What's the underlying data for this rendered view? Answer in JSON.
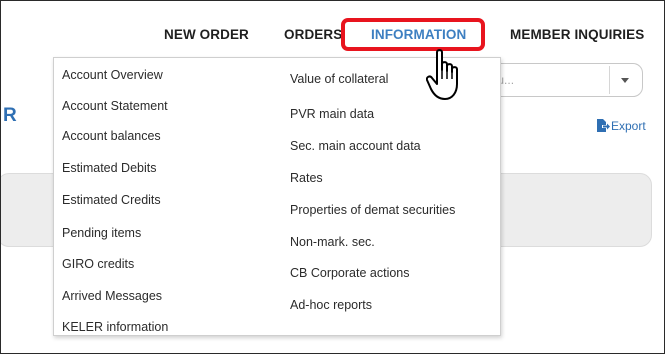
{
  "nav": {
    "new_order": "NEW ORDER",
    "orders": "ORDERS",
    "information": "INFORMATION",
    "member_inquiries": "MEMBER INQUIRIES"
  },
  "header_fragment": "R",
  "search": {
    "placeholder": "enu..."
  },
  "export_label": "Export",
  "menu": {
    "left_column": [
      "Account Overview",
      "Account Statement",
      "Account balances",
      "Estimated Debits",
      "Estimated Credits",
      "Pending items",
      "GIRO credits",
      "Arrived Messages",
      "KELER information"
    ],
    "right_column": [
      "Value of collateral",
      "PVR main data",
      "Sec. main account data",
      "Rates",
      "Properties of demat securities",
      "Non-mark. sec.",
      "CB Corporate actions",
      "Ad-hoc reports"
    ]
  },
  "colors": {
    "active_nav": "#3d7fc1",
    "highlight": "#e8141e",
    "link": "#2f6fb3"
  },
  "icons": [
    "chevron-down-icon",
    "export-icon",
    "hand-cursor-icon"
  ]
}
